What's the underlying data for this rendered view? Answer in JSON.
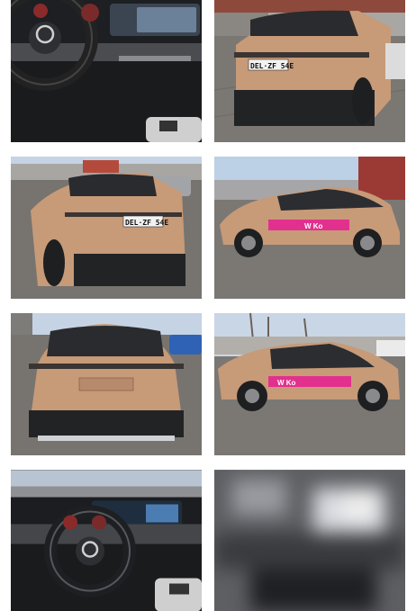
{
  "gallery": {
    "photos": [
      {
        "subject": "interior-dashboard-steering-wheel"
      },
      {
        "subject": "rear-three-quarter-view",
        "plate": "DEL·ZF 54E"
      },
      {
        "subject": "rear-three-quarter-view",
        "plate": "DEL·ZF 54E"
      },
      {
        "subject": "side-view-with-decal",
        "decal": "W Ko"
      },
      {
        "subject": "rear-view"
      },
      {
        "subject": "side-view-with-decal",
        "decal": "W Ko"
      },
      {
        "subject": "interior-dashboard-steering-wheel"
      },
      {
        "subject": "blurred-placeholder"
      }
    ]
  },
  "colors": {
    "car_body": "#c79a78",
    "decal_pink": "#e2308f",
    "asphalt": "#75726e",
    "sky": "#c5d3e4"
  }
}
